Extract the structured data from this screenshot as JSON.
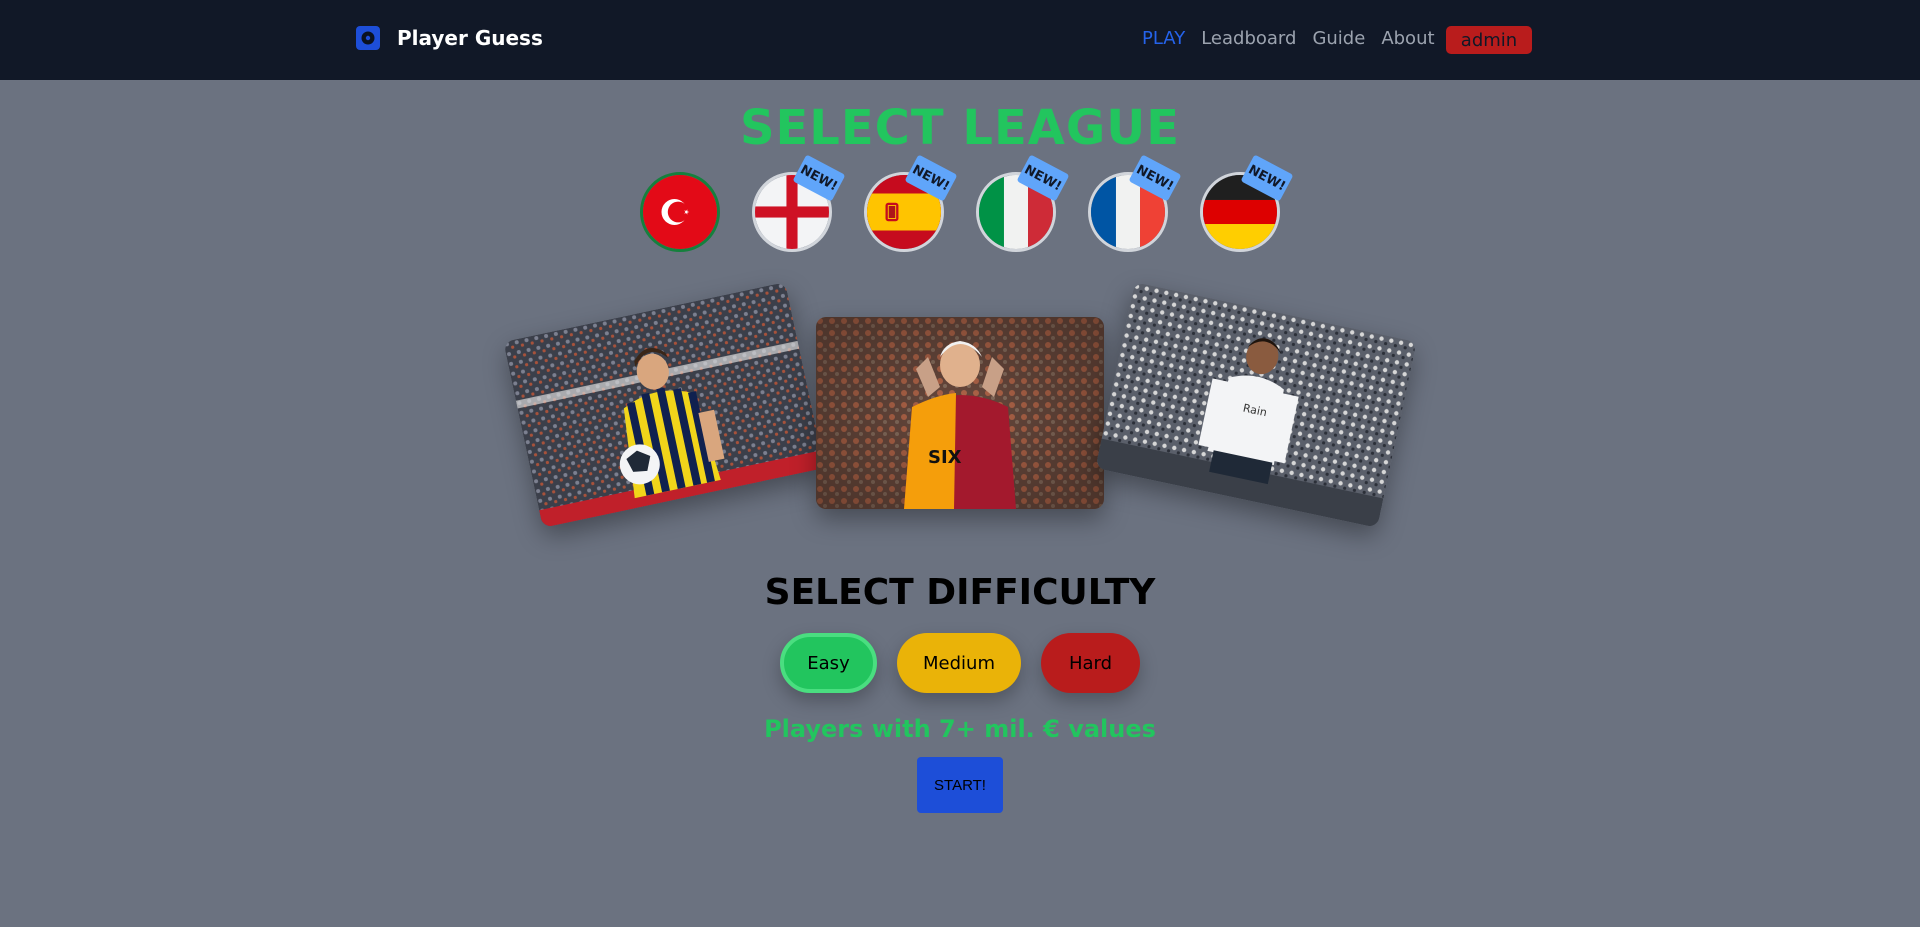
{
  "navbar": {
    "brand": "Player Guess",
    "links": [
      {
        "label": "PLAY",
        "active": true
      },
      {
        "label": "Leadboard",
        "active": false
      },
      {
        "label": "Guide",
        "active": false
      },
      {
        "label": "About",
        "active": false
      }
    ],
    "admin_label": "admin"
  },
  "league": {
    "title": "SELECT LEAGUE",
    "flags": [
      {
        "country": "turkey",
        "icon": "turkey-flag-icon",
        "selected": true,
        "badge": ""
      },
      {
        "country": "england",
        "icon": "england-flag-icon",
        "selected": false,
        "badge": "NEW!"
      },
      {
        "country": "spain",
        "icon": "spain-flag-icon",
        "selected": false,
        "badge": "NEW!"
      },
      {
        "country": "italy",
        "icon": "italy-flag-icon",
        "selected": false,
        "badge": "NEW!"
      },
      {
        "country": "france",
        "icon": "france-flag-icon",
        "selected": false,
        "badge": "NEW!"
      },
      {
        "country": "germany",
        "icon": "germany-flag-icon",
        "selected": false,
        "badge": "NEW!"
      }
    ]
  },
  "players": [
    {
      "name": "player-photo-left",
      "jersey": "yellow-navy stripes"
    },
    {
      "name": "player-photo-center",
      "jersey": "red-yellow"
    },
    {
      "name": "player-photo-right",
      "jersey": "white"
    }
  ],
  "difficulty": {
    "title": "SELECT DIFFICULTY",
    "options": [
      {
        "label": "Easy",
        "selected": true
      },
      {
        "label": "Medium",
        "selected": false
      },
      {
        "label": "Hard",
        "selected": false
      }
    ],
    "description": "Players with 7+ mil. € values",
    "start_label": "START!"
  },
  "colors": {
    "background": "#6b7280",
    "navbar": "#111827",
    "accent_green": "#22c55e",
    "accent_blue": "#1d4ed8",
    "admin_red": "#b91c1c",
    "medium_yellow": "#eab308"
  }
}
